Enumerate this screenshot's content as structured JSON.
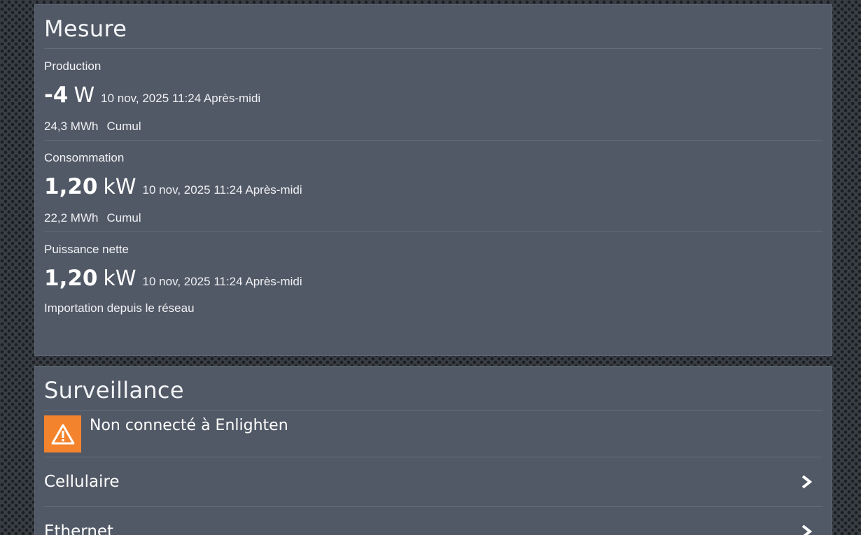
{
  "mesure": {
    "title": "Mesure",
    "production": {
      "label": "Production",
      "value": "-4",
      "unit": "W",
      "timestamp": "10 nov, 2025 11:24 Après-midi",
      "cumul_value": "24,3 MWh",
      "cumul_label": "Cumul"
    },
    "consommation": {
      "label": "Consommation",
      "value": "1,20",
      "unit": "kW",
      "timestamp": "10 nov, 2025 11:24 Après-midi",
      "cumul_value": "22,2 MWh",
      "cumul_label": "Cumul"
    },
    "puissance_nette": {
      "label": "Puissance nette",
      "value": "1,20",
      "unit": "kW",
      "timestamp": "10 nov, 2025 11:24 Après-midi",
      "note": "Importation depuis le réseau"
    }
  },
  "surveillance": {
    "title": "Surveillance",
    "alert": {
      "text": "Non connecté à Enlighten",
      "icon": "warning-icon",
      "color": "#f4832e"
    },
    "items": [
      {
        "label": "Cellulaire",
        "icon": "chevron-right-icon"
      },
      {
        "label": "Ethernet",
        "icon": "chevron-right-icon"
      }
    ]
  }
}
